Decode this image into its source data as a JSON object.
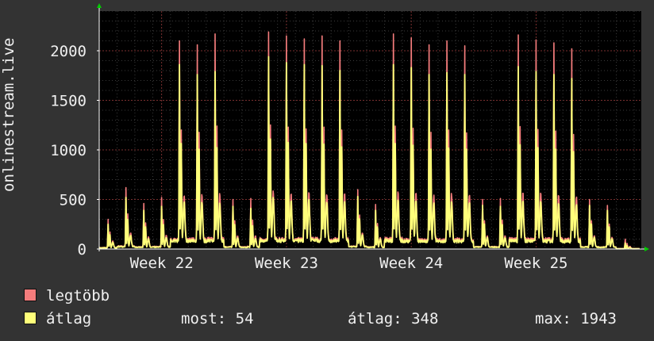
{
  "chart_data": {
    "type": "line",
    "ylabel": "onlinestream.live",
    "ylim": [
      0,
      2400
    ],
    "y_ticks": [
      0,
      500,
      1000,
      1500,
      2000
    ],
    "x_tick_labels": [
      "Week 22",
      "Week 23",
      "Week 24",
      "Week 25"
    ],
    "x_tick_positions": [
      3.5,
      10.5,
      17.5,
      24.5
    ],
    "xlim": [
      0,
      30.4
    ],
    "grid": true,
    "series": [
      {
        "name": "legtöbb",
        "color": "#f47c7c",
        "values": [
          300,
          620,
          460,
          520,
          2100,
          2060,
          2170,
          500,
          510,
          2190,
          2150,
          2120,
          2150,
          2100,
          600,
          450,
          2170,
          2130,
          2060,
          2100,
          2050,
          500,
          510,
          2160,
          2110,
          2080,
          2020,
          500,
          440,
          100
        ]
      },
      {
        "name": "átlag",
        "color": "#ffff7a",
        "values": [
          250,
          520,
          390,
          430,
          1860,
          1760,
          1790,
          430,
          410,
          1940,
          1880,
          1860,
          1850,
          1800,
          530,
          390,
          1860,
          1830,
          1760,
          1780,
          1760,
          440,
          430,
          1840,
          1790,
          1760,
          1720,
          440,
          390,
          60
        ]
      }
    ]
  },
  "legend": {
    "max_label": "legtöbb",
    "avg_label": "átlag",
    "max_color": "#f47c7c",
    "avg_color": "#ffff7a"
  },
  "stats": {
    "now": "most: 54",
    "avg": "átlag: 348",
    "max": "max: 1943"
  }
}
